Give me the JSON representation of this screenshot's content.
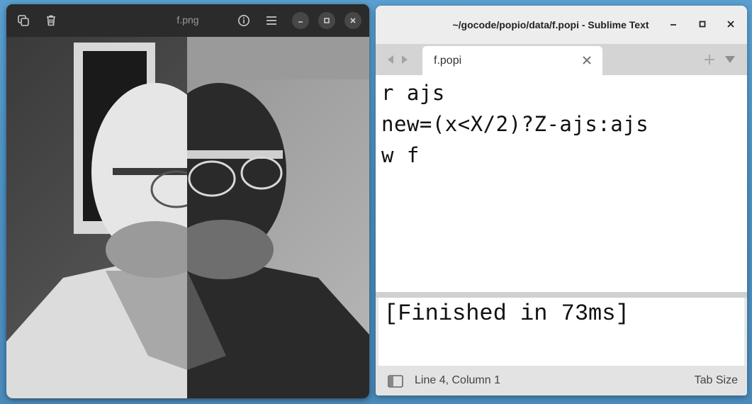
{
  "image_viewer": {
    "title": "f.png",
    "icons": [
      "copy-icon",
      "trash-icon",
      "info-icon",
      "menu-icon",
      "minimize-icon",
      "maximize-icon",
      "close-icon"
    ]
  },
  "sublime": {
    "title": "~/gocode/popio/data/f.popi - Sublime Text",
    "tab_label": "f.popi",
    "code_lines": [
      "r ajs",
      "new=(x<X/2)?Z-ajs:ajs",
      "w f"
    ],
    "output_text": "[Finished in 73ms]",
    "status_position": "Line 4, Column 1",
    "status_tab_size": "Tab Size"
  },
  "colors": {
    "desktop": "#4d91c2",
    "viewer_bar": "#2b2b2b",
    "sublime_tabbar": "#d4d4d4"
  }
}
